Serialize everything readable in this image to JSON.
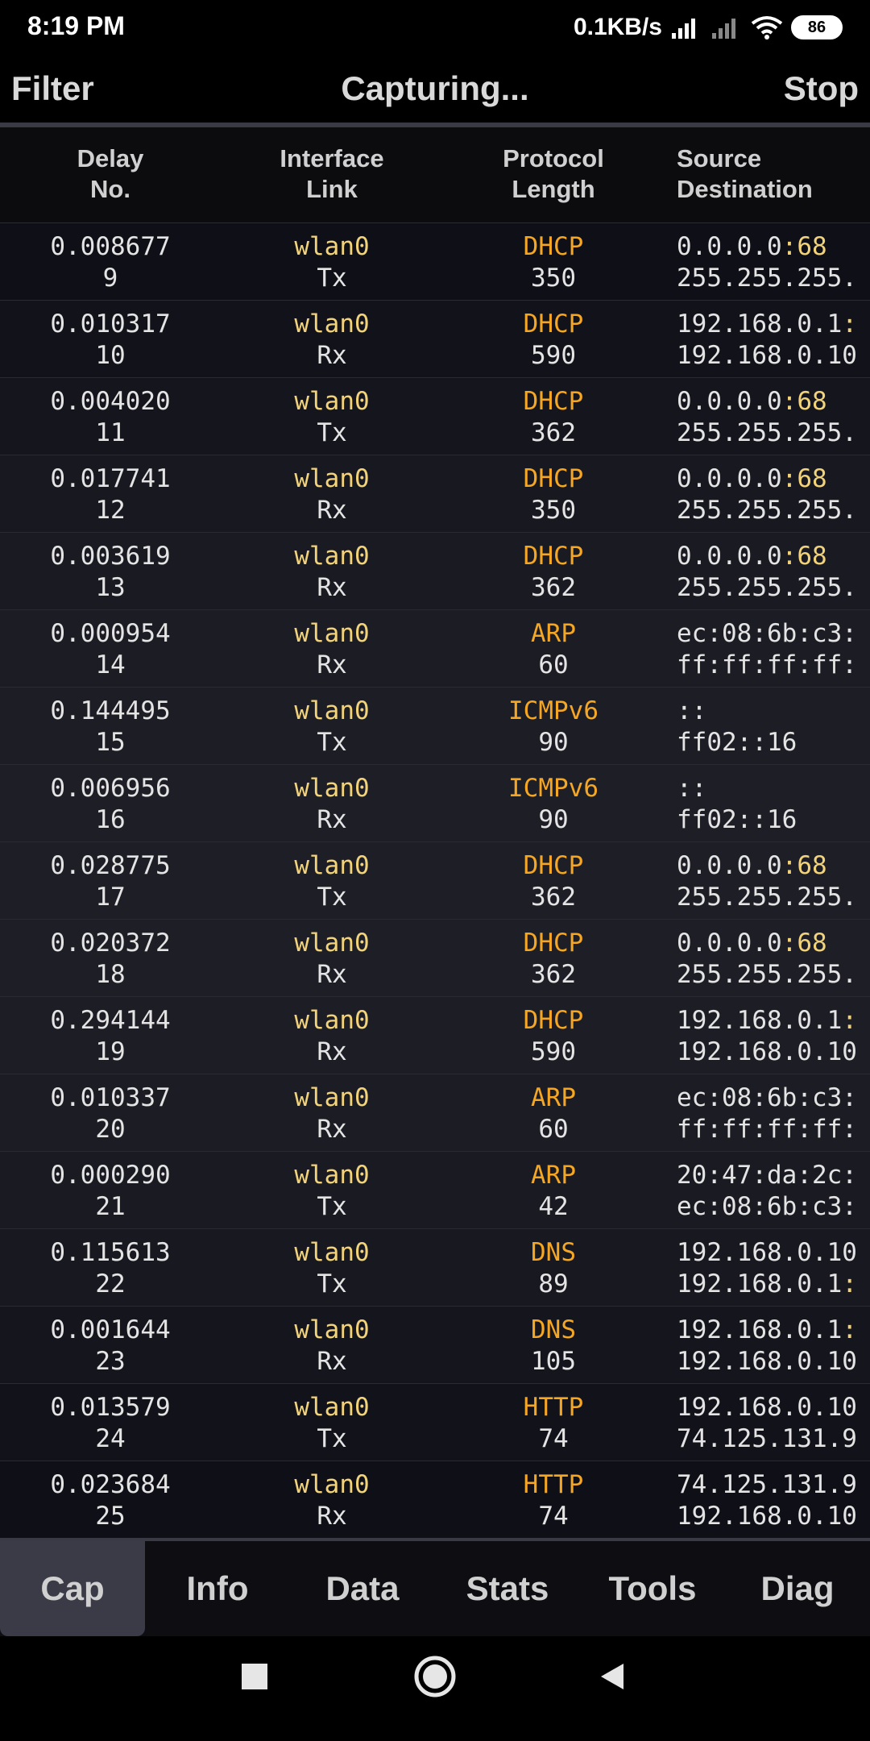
{
  "status_bar": {
    "time": "8:19 PM",
    "net_speed": "0.1KB/s",
    "battery": "86"
  },
  "action_bar": {
    "filter_label": "Filter",
    "title": "Capturing...",
    "stop_label": "Stop"
  },
  "columns": {
    "col1_top": "Delay",
    "col1_bottom": "No.",
    "col2_top": "Interface",
    "col2_bottom": "Link",
    "col3_top": "Protocol",
    "col3_bottom": "Length",
    "col4_top": "Source",
    "col4_bottom": "Destination"
  },
  "packets": [
    {
      "delay": "0.008677",
      "no": "9",
      "iface": "wlan0",
      "link": "Tx",
      "proto": "DHCP",
      "len": "350",
      "src_addr": "0.0.0.0",
      "src_port": ":68",
      "dst_addr": "255.255.255.",
      "dst_port": ""
    },
    {
      "delay": "0.010317",
      "no": "10",
      "iface": "wlan0",
      "link": "Rx",
      "proto": "DHCP",
      "len": "590",
      "src_addr": "192.168.0.1",
      "src_port": ":",
      "dst_addr": "192.168.0.10",
      "dst_port": ""
    },
    {
      "delay": "0.004020",
      "no": "11",
      "iface": "wlan0",
      "link": "Tx",
      "proto": "DHCP",
      "len": "362",
      "src_addr": "0.0.0.0",
      "src_port": ":68",
      "dst_addr": "255.255.255.",
      "dst_port": ""
    },
    {
      "delay": "0.017741",
      "no": "12",
      "iface": "wlan0",
      "link": "Rx",
      "proto": "DHCP",
      "len": "350",
      "src_addr": "0.0.0.0",
      "src_port": ":68",
      "dst_addr": "255.255.255.",
      "dst_port": ""
    },
    {
      "delay": "0.003619",
      "no": "13",
      "iface": "wlan0",
      "link": "Rx",
      "proto": "DHCP",
      "len": "362",
      "src_addr": "0.0.0.0",
      "src_port": ":68",
      "dst_addr": "255.255.255.",
      "dst_port": ""
    },
    {
      "delay": "0.000954",
      "no": "14",
      "iface": "wlan0",
      "link": "Rx",
      "proto": "ARP",
      "len": "60",
      "src_addr": "ec:08:6b:c3:",
      "src_port": "",
      "dst_addr": "ff:ff:ff:ff:",
      "dst_port": ""
    },
    {
      "delay": "0.144495",
      "no": "15",
      "iface": "wlan0",
      "link": "Tx",
      "proto": "ICMPv6",
      "len": "90",
      "src_addr": "::",
      "src_port": "",
      "dst_addr": "ff02::16",
      "dst_port": ""
    },
    {
      "delay": "0.006956",
      "no": "16",
      "iface": "wlan0",
      "link": "Rx",
      "proto": "ICMPv6",
      "len": "90",
      "src_addr": "::",
      "src_port": "",
      "dst_addr": "ff02::16",
      "dst_port": ""
    },
    {
      "delay": "0.028775",
      "no": "17",
      "iface": "wlan0",
      "link": "Tx",
      "proto": "DHCP",
      "len": "362",
      "src_addr": "0.0.0.0",
      "src_port": ":68",
      "dst_addr": "255.255.255.",
      "dst_port": ""
    },
    {
      "delay": "0.020372",
      "no": "18",
      "iface": "wlan0",
      "link": "Rx",
      "proto": "DHCP",
      "len": "362",
      "src_addr": "0.0.0.0",
      "src_port": ":68",
      "dst_addr": "255.255.255.",
      "dst_port": ""
    },
    {
      "delay": "0.294144",
      "no": "19",
      "iface": "wlan0",
      "link": "Rx",
      "proto": "DHCP",
      "len": "590",
      "src_addr": "192.168.0.1",
      "src_port": ":",
      "dst_addr": "192.168.0.10",
      "dst_port": ""
    },
    {
      "delay": "0.010337",
      "no": "20",
      "iface": "wlan0",
      "link": "Rx",
      "proto": "ARP",
      "len": "60",
      "src_addr": "ec:08:6b:c3:",
      "src_port": "",
      "dst_addr": "ff:ff:ff:ff:",
      "dst_port": ""
    },
    {
      "delay": "0.000290",
      "no": "21",
      "iface": "wlan0",
      "link": "Tx",
      "proto": "ARP",
      "len": "42",
      "src_addr": "20:47:da:2c:",
      "src_port": "",
      "dst_addr": "ec:08:6b:c3:",
      "dst_port": ""
    },
    {
      "delay": "0.115613",
      "no": "22",
      "iface": "wlan0",
      "link": "Tx",
      "proto": "DNS",
      "len": "89",
      "src_addr": "192.168.0.10",
      "src_port": "",
      "dst_addr": "192.168.0.1",
      "dst_port": ":"
    },
    {
      "delay": "0.001644",
      "no": "23",
      "iface": "wlan0",
      "link": "Rx",
      "proto": "DNS",
      "len": "105",
      "src_addr": "192.168.0.1",
      "src_port": ":",
      "dst_addr": "192.168.0.10",
      "dst_port": ""
    },
    {
      "delay": "0.013579",
      "no": "24",
      "iface": "wlan0",
      "link": "Tx",
      "proto": "HTTP",
      "len": "74",
      "src_addr": "192.168.0.10",
      "src_port": "",
      "dst_addr": "74.125.131.9",
      "dst_port": ""
    },
    {
      "delay": "0.023684",
      "no": "25",
      "iface": "wlan0",
      "link": "Rx",
      "proto": "HTTP",
      "len": "74",
      "src_addr": "74.125.131.9",
      "src_port": "",
      "dst_addr": "192.168.0.10",
      "dst_port": ""
    }
  ],
  "tabs": [
    {
      "label": "Cap",
      "active": true
    },
    {
      "label": "Info",
      "active": false
    },
    {
      "label": "Data",
      "active": false
    },
    {
      "label": "Stats",
      "active": false
    },
    {
      "label": "Tools",
      "active": false
    },
    {
      "label": "Diag",
      "active": false
    }
  ],
  "icons": {
    "signal_1": "signal-icon",
    "signal_2": "signal-icon",
    "wifi": "wifi-icon",
    "nav_recents": "square-icon",
    "nav_home": "circle-icon",
    "nav_back": "triangle-back-icon"
  },
  "colors": {
    "interface": "#f2d37a",
    "protocol": "#f5a623",
    "port": "#f2d37a",
    "active_tab": "#3b3b48"
  }
}
